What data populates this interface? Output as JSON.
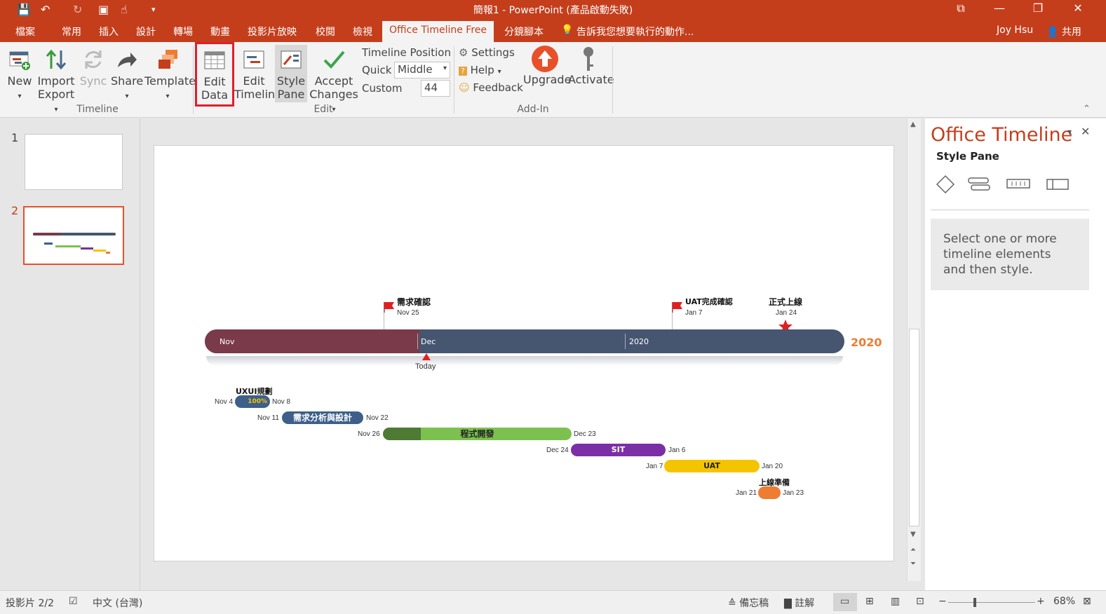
{
  "window": {
    "title": "簡報1 - PowerPoint (產品啟動失敗)"
  },
  "tabs": [
    {
      "label": "檔案"
    },
    {
      "label": "常用"
    },
    {
      "label": "插入"
    },
    {
      "label": "設計"
    },
    {
      "label": "轉場"
    },
    {
      "label": "動畫"
    },
    {
      "label": "投影片放映"
    },
    {
      "label": "校閱"
    },
    {
      "label": "檢視"
    },
    {
      "label": "Office Timeline Free"
    },
    {
      "label": "分鏡腳本"
    }
  ],
  "tell_me": "告訴我您想要執行的動作...",
  "user": {
    "name": "Joy Hsu",
    "share": "共用"
  },
  "ribbon": {
    "new": "New",
    "import": "Import",
    "export": "Export",
    "sync": "Sync",
    "share": "Share",
    "template": "Template",
    "edit_data_1": "Edit",
    "edit_data_2": "Data",
    "edit_timeline_1": "Edit",
    "edit_timeline_2": "Timeline",
    "style_pane_1": "Style",
    "style_pane_2": "Pane",
    "accept_1": "Accept",
    "accept_2": "Changes",
    "timeline_position": "Timeline Position",
    "quick": "Quick",
    "quick_value": "Middle",
    "custom": "Custom",
    "custom_value": "44",
    "settings": "Settings",
    "help": "Help",
    "feedback": "Feedback",
    "upgrade": "Upgrade",
    "activate": "Activate",
    "group_timeline": "Timeline",
    "group_edit": "Edit",
    "group_addin": "Add-In"
  },
  "thumbnails": [
    {
      "num": "1"
    },
    {
      "num": "2"
    }
  ],
  "timeline": {
    "months": [
      "Nov",
      "Dec",
      "2020"
    ],
    "year": "2020",
    "today": "Today",
    "milestones": [
      {
        "title": "需求確認",
        "date": "Nov 25"
      },
      {
        "title": "UAT完成確認",
        "date": "Jan 7"
      },
      {
        "title": "正式上線",
        "date": "Jan 24"
      }
    ],
    "tasks": [
      {
        "title": "UXUI規劃",
        "start": "Nov 4",
        "end": "Nov 8",
        "pct": "100%"
      },
      {
        "title": "需求分析與設計",
        "start": "Nov 11",
        "end": "Nov 22"
      },
      {
        "title": "程式開發",
        "start": "Nov 26",
        "end": "Dec 23"
      },
      {
        "title": "SIT",
        "start": "Dec 24",
        "end": "Jan 6"
      },
      {
        "title": "UAT",
        "start": "Jan 7",
        "end": "Jan 20"
      },
      {
        "title": "上線準備",
        "start": "Jan 21",
        "end": "Jan 23"
      }
    ],
    "colors": {
      "past": "#7b3a4a",
      "future": "#465670",
      "task1": "#3d5f8a",
      "task3": "#7cc150",
      "task4": "#7b2fa6",
      "task5": "#f5c400",
      "task6": "#ed7d31",
      "accent": "#c43e1c"
    }
  },
  "pane": {
    "title": "Office Timeline",
    "subtitle": "Style Pane",
    "hint": "Select one or more timeline elements and then style."
  },
  "status": {
    "slide": "投影片 2/2",
    "lang": "中文 (台灣)",
    "notes": "備忘稿",
    "comments": "註解",
    "zoom": "68%"
  }
}
